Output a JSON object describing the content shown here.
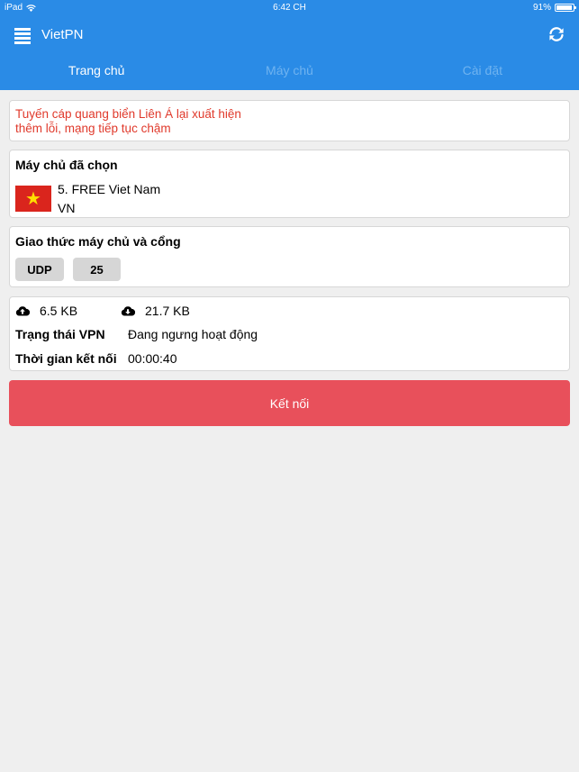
{
  "status_bar": {
    "device": "iPad",
    "time": "6:42 CH",
    "battery": "91%"
  },
  "nav": {
    "title": "VietPN"
  },
  "tabs": [
    {
      "label": "Trang chủ",
      "active": true
    },
    {
      "label": "Máy chủ",
      "active": false
    },
    {
      "label": "Cài đặt",
      "active": false
    }
  ],
  "notice": {
    "line1": "Tuyến cáp quang biển Liên Á lại xuất hiện",
    "line2": "thêm lỗi, mạng tiếp tục chậm"
  },
  "server": {
    "title": "Máy chủ đã chọn",
    "name": "5. FREE Viet Nam",
    "code": "VN",
    "flag_icon": "vietnam-flag-icon"
  },
  "protocol": {
    "title": "Giao thức máy chủ và cổng",
    "proto": "UDP",
    "port": "25"
  },
  "stats": {
    "upload": "6.5 KB",
    "download": "21.7 KB",
    "status_label": "Trạng thái VPN",
    "status_value": "Đang ngưng hoạt động",
    "time_label": "Thời gian kết nối",
    "time_value": "00:00:40"
  },
  "connect": {
    "label": "Kết nối"
  },
  "colors": {
    "primary": "#2a8be6",
    "danger": "#e8505b",
    "notice": "#e0392b"
  }
}
